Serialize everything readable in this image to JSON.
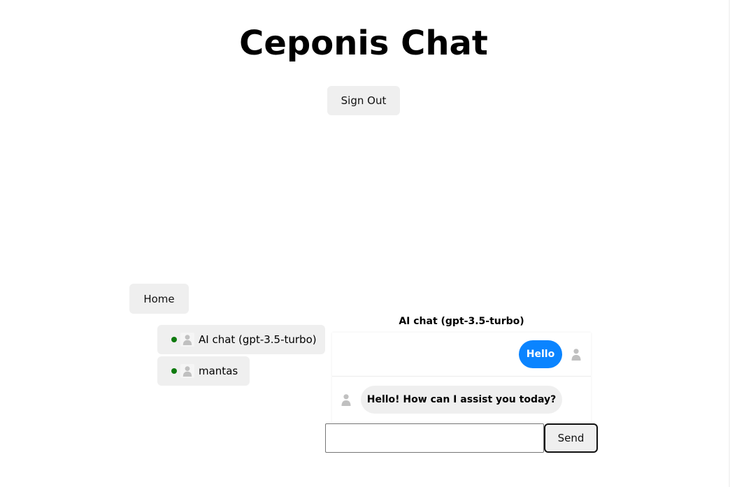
{
  "header": {
    "title": "Ceponis Chat",
    "sign_out_label": "Sign Out"
  },
  "nav": {
    "home_label": "Home"
  },
  "contacts": [
    {
      "name": "AI chat (gpt-3.5-turbo)",
      "online": true
    },
    {
      "name": "mantas",
      "online": true
    }
  ],
  "chat": {
    "title": "AI chat (gpt-3.5-turbo)",
    "messages": [
      {
        "sender": "user",
        "text": "Hello"
      },
      {
        "sender": "ai",
        "text": "Hello! How can I assist you today?"
      }
    ],
    "input_value": "",
    "send_label": "Send"
  },
  "colors": {
    "user_bubble": "#0a84ff",
    "ai_bubble": "#efefef",
    "online_dot": "#0f7a0f",
    "button_bg": "#efefef"
  },
  "icons": {
    "avatar": "user-icon",
    "status": "online-dot"
  }
}
